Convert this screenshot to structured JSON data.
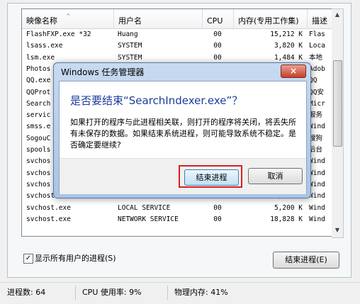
{
  "list": {
    "headers": [
      "映像名称",
      "用户名",
      "CPU",
      "内存(专用工作集)",
      "描述"
    ],
    "rows": [
      {
        "name": "FlashFXP.exe *32",
        "user": "Huang",
        "cpu": "00",
        "mem": "15,212 K",
        "desc": "Flas"
      },
      {
        "name": "lsass.exe",
        "user": "SYSTEM",
        "cpu": "00",
        "mem": "3,820 K",
        "desc": "Loca"
      },
      {
        "name": "lsm.exe",
        "user": "SYSTEM",
        "cpu": "00",
        "mem": "1,484 K",
        "desc": "本地"
      },
      {
        "name": "Photos",
        "user": "",
        "cpu": "",
        "mem": "",
        "desc": "Adob"
      },
      {
        "name": "QQ.exe",
        "user": "",
        "cpu": "",
        "mem": "",
        "desc": "QQ"
      },
      {
        "name": "QQProt",
        "user": "",
        "cpu": "",
        "mem": "",
        "desc": "QQ安"
      },
      {
        "name": "Search",
        "user": "",
        "cpu": "",
        "mem": "",
        "desc": "Micr"
      },
      {
        "name": "servic",
        "user": "",
        "cpu": "",
        "mem": "",
        "desc": "服务"
      },
      {
        "name": "smss.e",
        "user": "",
        "cpu": "",
        "mem": "",
        "desc": "Wind"
      },
      {
        "name": "SogouC",
        "user": "",
        "cpu": "",
        "mem": "",
        "desc": "搜狗"
      },
      {
        "name": "spools",
        "user": "",
        "cpu": "",
        "mem": "",
        "desc": "后台"
      },
      {
        "name": "svchos",
        "user": "",
        "cpu": "",
        "mem": "",
        "desc": "Wind"
      },
      {
        "name": "svchos",
        "user": "",
        "cpu": "",
        "mem": "",
        "desc": "Wind"
      },
      {
        "name": "svchos",
        "user": "",
        "cpu": "",
        "mem": "",
        "desc": "Wind"
      },
      {
        "name": "svchost.exe",
        "user": "SYSTEM",
        "cpu": "00",
        "mem": "5,456 K",
        "desc": "Wind"
      },
      {
        "name": "svchost.exe",
        "user": "LOCAL SERVICE",
        "cpu": "00",
        "mem": "5,200 K",
        "desc": "Wind"
      },
      {
        "name": "svchost.exe",
        "user": "NETWORK SERVICE",
        "cpu": "00",
        "mem": "18,828 K",
        "desc": "Wind"
      }
    ]
  },
  "show_all_label": "显示所有用户的进程(S)",
  "end_process_button": "结束进程(E)",
  "status": {
    "processes": "进程数: 64",
    "cpu": "CPU 使用率: 9%",
    "memory": "物理内存: 41%"
  },
  "dialog": {
    "title": "Windows 任务管理器",
    "close_glyph": "×",
    "question": "是否要结束“SearchIndexer.exe”？",
    "message": "如果打开的程序与此进程相关联，则打开的程序将关闭，将丢失所有未保存的数据。如果结束系统进程，则可能导致系统不稳定。是否确定要继续?",
    "confirm_label": "结束进程",
    "cancel_label": "取消"
  },
  "colors": {
    "highlight_border": "#d92020",
    "question_text": "#1b3c9a"
  }
}
